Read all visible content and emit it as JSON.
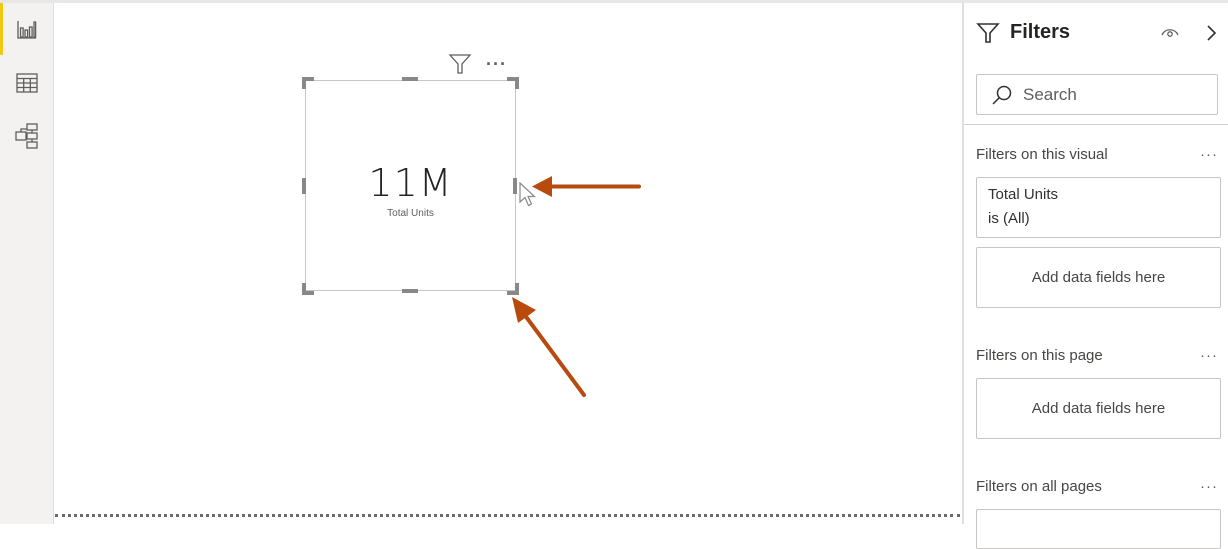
{
  "left_rail": {
    "items": [
      {
        "name": "report-view",
        "icon": "bar-chart-icon",
        "active": true
      },
      {
        "name": "data-view",
        "icon": "table-icon",
        "active": false
      },
      {
        "name": "model-view",
        "icon": "model-icon",
        "active": false
      }
    ],
    "accent_color": "#f2c811"
  },
  "visual": {
    "type": "card",
    "value": "11M",
    "label": "Total Units",
    "header_icons": [
      "filter-icon",
      "more-options-icon"
    ],
    "more_label": "···"
  },
  "annotations": {
    "arrow_color": "#b84a0e",
    "arrows": [
      "arrow-to-right-edge-handle",
      "arrow-to-bottom-right-corner"
    ]
  },
  "filters_pane": {
    "title": "Filters",
    "search_placeholder": "Search",
    "sections": [
      {
        "title": "Filters on this visual",
        "more": "···",
        "filter_cards": [
          {
            "field": "Total Units",
            "condition": "is (All)"
          }
        ],
        "drop_label": "Add data fields here"
      },
      {
        "title": "Filters on this page",
        "more": "···",
        "drop_label": "Add data fields here"
      },
      {
        "title": "Filters on all pages",
        "more": "···"
      }
    ]
  }
}
